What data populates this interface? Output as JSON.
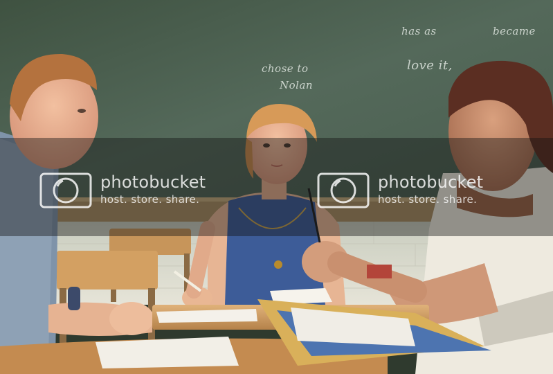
{
  "chalkboard": {
    "line_1": "has as",
    "line_2": "became",
    "line_3": "love it,",
    "line_4": "chose to",
    "line_5": "Nolan"
  },
  "watermark": {
    "brand": "photobucket",
    "tagline": "host. store. share."
  },
  "colors": {
    "chalkboard": "#4f6450",
    "wall": "#d9dcd3",
    "desk": "#d8a96a",
    "watermark_band": "#141414"
  }
}
